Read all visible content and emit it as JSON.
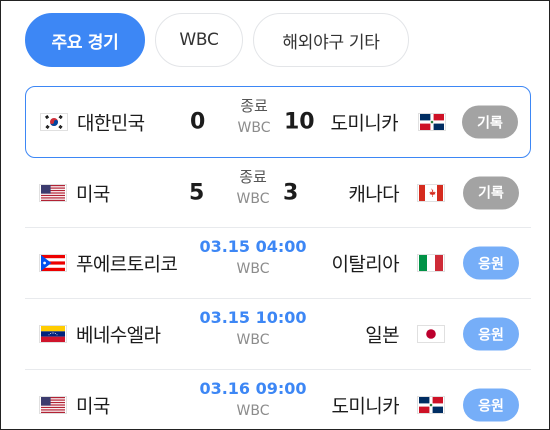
{
  "tabs": [
    {
      "label": "주요 경기",
      "active": true
    },
    {
      "label": "WBC",
      "active": false
    },
    {
      "label": "해외야구 기타",
      "active": false
    }
  ],
  "colors": {
    "accent": "#3d87f5",
    "record_button": "#a3a3a3",
    "cheer_button": "#76aef8"
  },
  "games": [
    {
      "home_team": "대한민국",
      "home_flag": "south-korea-flag-icon",
      "home_score": "0",
      "status": "종료",
      "time": "",
      "league": "WBC",
      "away_team": "도미니카",
      "away_flag": "dominican-republic-flag-icon",
      "away_score": "10",
      "button": "기록",
      "button_type": "record",
      "highlighted": true
    },
    {
      "home_team": "미국",
      "home_flag": "usa-flag-icon",
      "home_score": "5",
      "status": "종료",
      "time": "",
      "league": "WBC",
      "away_team": "캐나다",
      "away_flag": "canada-flag-icon",
      "away_score": "3",
      "button": "기록",
      "button_type": "record",
      "highlighted": false
    },
    {
      "home_team": "푸에르토리코",
      "home_flag": "puerto-rico-flag-icon",
      "home_score": "",
      "status": "",
      "time": "03.15 04:00",
      "league": "WBC",
      "away_team": "이탈리아",
      "away_flag": "italy-flag-icon",
      "away_score": "",
      "button": "응원",
      "button_type": "cheer",
      "highlighted": false
    },
    {
      "home_team": "베네수엘라",
      "home_flag": "venezuela-flag-icon",
      "home_score": "",
      "status": "",
      "time": "03.15 10:00",
      "league": "WBC",
      "away_team": "일본",
      "away_flag": "japan-flag-icon",
      "away_score": "",
      "button": "응원",
      "button_type": "cheer",
      "highlighted": false
    },
    {
      "home_team": "미국",
      "home_flag": "usa-flag-icon",
      "home_score": "",
      "status": "",
      "time": "03.16 09:00",
      "league": "WBC",
      "away_team": "도미니카",
      "away_flag": "dominican-republic-flag-icon",
      "away_score": "",
      "button": "응원",
      "button_type": "cheer",
      "highlighted": false
    }
  ]
}
